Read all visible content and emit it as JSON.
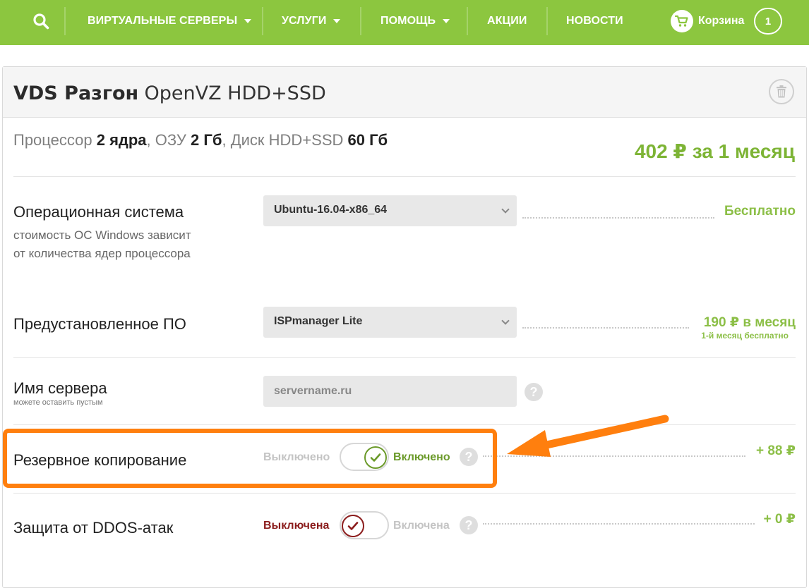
{
  "nav": {
    "items": [
      {
        "label": "ВИРТУАЛЬНЫЕ СЕРВЕРЫ",
        "caret": true
      },
      {
        "label": "УСЛУГИ",
        "caret": true
      },
      {
        "label": "ПОМОЩЬ",
        "caret": true
      },
      {
        "label": "АКЦИИ",
        "caret": false
      },
      {
        "label": "НОВОСТИ",
        "caret": false
      }
    ],
    "cart_label": "Корзина",
    "cart_count": "1"
  },
  "panel": {
    "title_bold": "VDS Разгон",
    "title_rest": "OpenVZ HDD+SSD",
    "specs": {
      "cpu_label": "Процессор",
      "cpu_value": "2 ядра",
      "ram_label": "ОЗУ",
      "ram_value": "2 Гб",
      "disk_label": "Диск HDD+SSD",
      "disk_value": "60 Гб"
    },
    "price_main": "402 ₽ за 1 месяц"
  },
  "rows": {
    "os": {
      "label": "Операционная система",
      "sub_line1": "стоимость ОС Windows зависит",
      "sub_line2": "от количества ядер процессора",
      "selected": "Ubuntu-16.04-x86_64",
      "price": "Бесплатно"
    },
    "software": {
      "label": "Предустановленное ПО",
      "selected": "ISPmanager Lite",
      "price": "190 ₽ в месяц",
      "price_note": "1-й месяц бесплатно"
    },
    "server_name": {
      "label": "Имя сервера",
      "sub": "можете оставить пустым",
      "placeholder": "servername.ru"
    },
    "backup": {
      "label": "Резервное копирование",
      "off_label": "Выключено",
      "on_label": "Включено",
      "state": "on",
      "price": "+ 88 ₽"
    },
    "ddos": {
      "label": "Защита от DDOS-атак",
      "off_label": "Выключена",
      "on_label": "Включена",
      "state": "off",
      "price": "+ 0 ₽"
    }
  },
  "colors": {
    "brand_green": "#8cc63f",
    "price_green": "#7db435",
    "toggle_on": "#6b9a2a",
    "toggle_off": "#8b1c1c",
    "highlight": "#ff7f0e"
  }
}
